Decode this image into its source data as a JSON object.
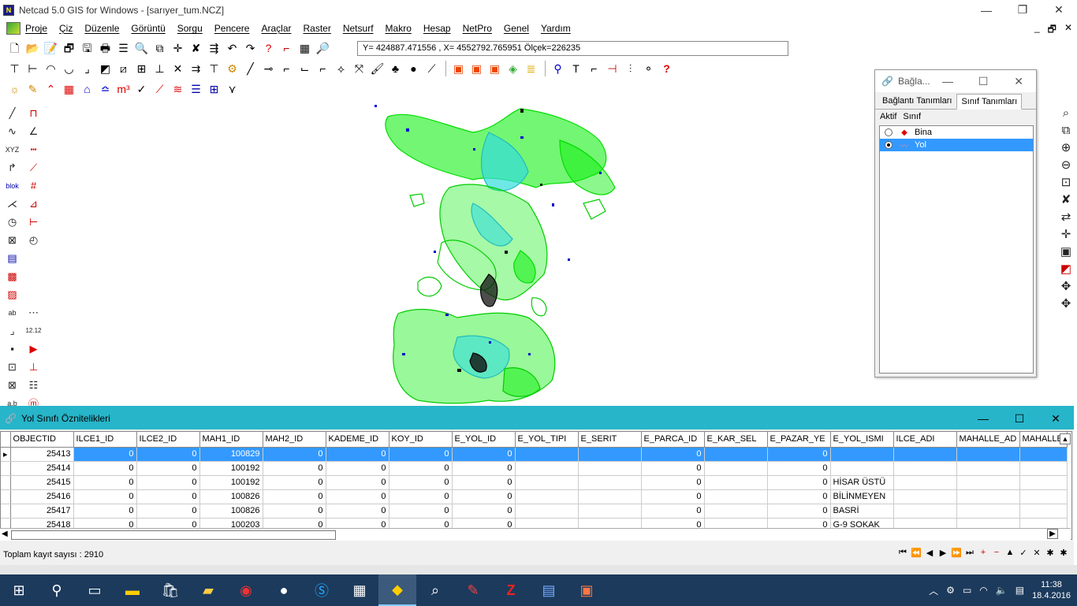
{
  "window": {
    "title": "Netcad 5.0 GIS for Windows - [sarıyer_tum.NCZ]",
    "app_icon": "netcad-logo-icon",
    "minimize": "—",
    "restore": "❐",
    "close": "✕"
  },
  "menu": {
    "items": [
      "Proje",
      "Çiz",
      "Düzenle",
      "Görüntü",
      "Sorgu",
      "Pencere",
      "Araçlar",
      "Raster",
      "Netsurf",
      "Makro",
      "Hesap",
      "NetPro",
      "Genel",
      "Yardım"
    ],
    "mdi_min": "_",
    "mdi_restore": "🗗",
    "mdi_close": "✕"
  },
  "coord_text": "Y= 424887.471556 , X= 4552792.765951 Ölçek=226235",
  "panel": {
    "title": "Bağla...",
    "tabs": [
      "Bağlantı Tanımları",
      "Sınıf Tanımları"
    ],
    "active_tab": 1,
    "headers": [
      "Aktif",
      "Sınıf"
    ],
    "rows": [
      {
        "name": "Bina",
        "active": false,
        "icon": "red-diamond-icon",
        "color": "#e00000"
      },
      {
        "name": "Yol",
        "active": true,
        "icon": "road-line-icon",
        "color": "#e05050"
      }
    ]
  },
  "attr": {
    "title": "Yol Sınıfı Öznitelikleri",
    "columns": [
      "OBJECTID",
      "ILCE1_ID",
      "ILCE2_ID",
      "MAH1_ID",
      "MAH2_ID",
      "KADEME_ID",
      "KOY_ID",
      "E_YOL_ID",
      "E_YOL_TIPI",
      "E_SERIT",
      "E_PARCA_ID",
      "E_KAR_SEL",
      "E_PAZAR_YE",
      "E_YOL_ISMI",
      "ILCE_ADI",
      "MAHALLE_AD",
      "MAHALLE"
    ],
    "rows": [
      [
        "25413",
        "0",
        "0",
        "100829",
        "0",
        "0",
        "0",
        "0",
        "",
        "",
        "0",
        "",
        "0",
        "",
        "",
        "",
        ""
      ],
      [
        "25414",
        "0",
        "0",
        "100192",
        "0",
        "0",
        "0",
        "0",
        "",
        "",
        "0",
        "",
        "0",
        "",
        "",
        "",
        ""
      ],
      [
        "25415",
        "0",
        "0",
        "100192",
        "0",
        "0",
        "0",
        "0",
        "",
        "",
        "0",
        "",
        "0",
        "HİSAR ÜSTÜ",
        "",
        "",
        ""
      ],
      [
        "25416",
        "0",
        "0",
        "100826",
        "0",
        "0",
        "0",
        "0",
        "",
        "",
        "0",
        "",
        "0",
        "BİLİNMEYEN",
        "",
        "",
        ""
      ],
      [
        "25417",
        "0",
        "0",
        "100826",
        "0",
        "0",
        "0",
        "0",
        "",
        "",
        "0",
        "",
        "0",
        "BASRİ",
        "",
        "",
        ""
      ],
      [
        "25418",
        "0",
        "0",
        "100203",
        "0",
        "0",
        "0",
        "0",
        "",
        "",
        "0",
        "",
        "0",
        "G-9 SOKAK",
        "",
        "",
        ""
      ]
    ],
    "selected_row": 0,
    "status": "Toplam kayıt sayısı : 2910",
    "nav": [
      "⏮",
      "⏪",
      "◀",
      "▶",
      "⏩",
      "⏭",
      "+",
      "−",
      "▲",
      "✓",
      "✕",
      "✱",
      "✱"
    ]
  },
  "taskbar": {
    "items": [
      "windows-start-icon",
      "search-icon",
      "task-view-icon",
      "file-explorer-icon",
      "store-icon",
      "folder-icon",
      "chrome-icon",
      "browser-icon",
      "skype-icon",
      "calculator-icon",
      "netcad-icon",
      "magnifier-icon",
      "paint-icon",
      "filezilla-icon",
      "notes-icon",
      "app-icon"
    ],
    "active_index": 10,
    "time": "11:38",
    "date": "18.4.2016"
  },
  "colors": {
    "accent": "#27b5c9",
    "selection": "#3399ff",
    "taskbar": "#1c3a5c",
    "map_green": "#00dd00",
    "map_cyan": "#33dddd",
    "map_blue": "#0000cc"
  }
}
